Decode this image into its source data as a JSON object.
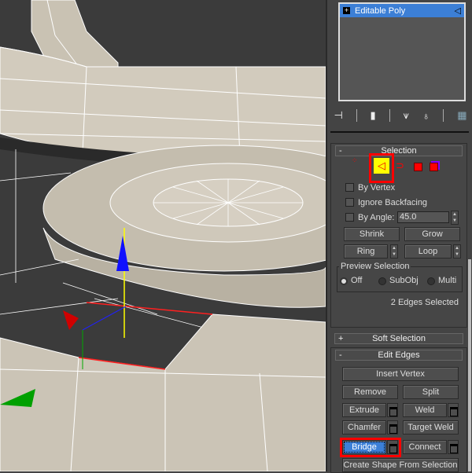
{
  "modifier_stack": {
    "item": "Editable Poly"
  },
  "selection": {
    "title": "Selection",
    "collapse": "-",
    "by_vertex": "By Vertex",
    "ignore_backfacing": "Ignore Backfacing",
    "by_angle": "By Angle:",
    "angle_value": "45.0",
    "shrink": "Shrink",
    "grow": "Grow",
    "ring": "Ring",
    "loop": "Loop",
    "preview_title": "Preview Selection",
    "off": "Off",
    "subobj": "SubObj",
    "multi": "Multi",
    "preview_selected": "Off",
    "status": "2 Edges Selected",
    "active_level": "edge"
  },
  "soft_selection": {
    "title": "Soft Selection",
    "expand": "+"
  },
  "edit_edges": {
    "title": "Edit Edges",
    "collapse": "-",
    "insert_vertex": "Insert Vertex",
    "remove": "Remove",
    "split": "Split",
    "extrude": "Extrude",
    "weld": "Weld",
    "chamfer": "Chamfer",
    "target_weld": "Target Weld",
    "bridge": "Bridge",
    "connect": "Connect",
    "create_shape": "Create Shape From Selection"
  },
  "colors": {
    "highlight": "#ff0000",
    "active_button": "#3c7fd6",
    "edge_mode": "#ffff00",
    "mesh": "#cdc6b8"
  }
}
